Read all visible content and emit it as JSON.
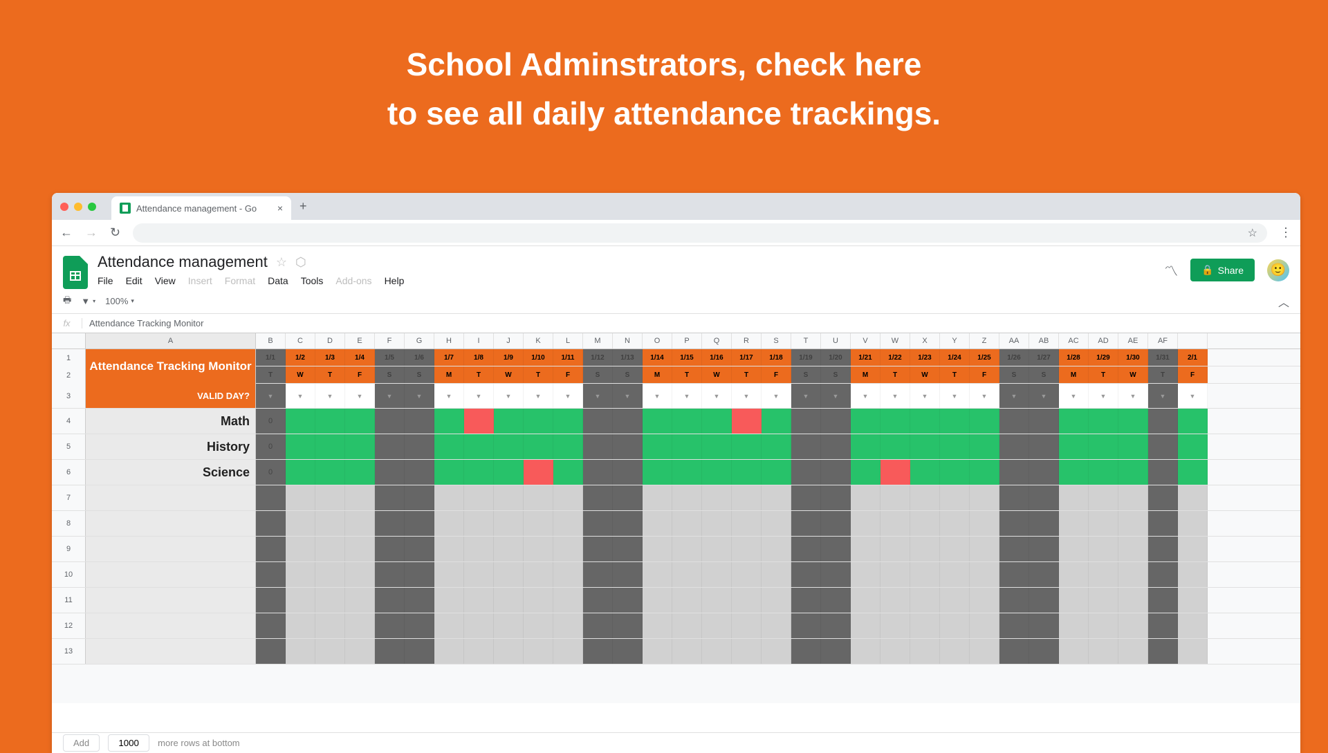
{
  "hero": {
    "line1": "School Adminstrators, check here",
    "line2": "to see all daily attendance trackings."
  },
  "browser": {
    "tab_title": "Attendance management - Go",
    "back": "←",
    "forward": "→",
    "reload": "⟳"
  },
  "sheets": {
    "doc_title": "Attendance management",
    "menus": [
      "File",
      "Edit",
      "View",
      "Insert",
      "Format",
      "Data",
      "Tools",
      "Add-ons",
      "Help"
    ],
    "menu_disabled": [
      "Insert",
      "Format",
      "Add-ons"
    ],
    "share_label": "Share",
    "zoom": "100%",
    "formula_text": "Attendance Tracking Monitor"
  },
  "grid": {
    "col_a": "A",
    "cols": [
      "B",
      "C",
      "D",
      "E",
      "F",
      "G",
      "H",
      "I",
      "J",
      "K",
      "L",
      "M",
      "N",
      "O",
      "P",
      "Q",
      "R",
      "S",
      "T",
      "U",
      "V",
      "W",
      "X",
      "Y",
      "Z",
      "AA",
      "AB",
      "AC",
      "AD",
      "AE",
      "AF",
      ""
    ],
    "row_nums": [
      "1",
      "2",
      "3",
      "4",
      "5",
      "6",
      "7",
      "8",
      "9",
      "10",
      "11",
      "12",
      "13"
    ],
    "title_merged": "Attendance Tracking Monitor",
    "valid_day_label": "VALID DAY?",
    "subjects": [
      "Math",
      "History",
      "Science"
    ],
    "subject_zero": "0",
    "dates": [
      {
        "label": "1/1",
        "type": "gray"
      },
      {
        "label": "1/2",
        "type": "orange"
      },
      {
        "label": "1/3",
        "type": "orange"
      },
      {
        "label": "1/4",
        "type": "orange"
      },
      {
        "label": "1/5",
        "type": "gray"
      },
      {
        "label": "1/6",
        "type": "gray"
      },
      {
        "label": "1/7",
        "type": "orange"
      },
      {
        "label": "1/8",
        "type": "orange"
      },
      {
        "label": "1/9",
        "type": "orange"
      },
      {
        "label": "1/10",
        "type": "orange"
      },
      {
        "label": "1/11",
        "type": "orange"
      },
      {
        "label": "1/12",
        "type": "gray"
      },
      {
        "label": "1/13",
        "type": "gray"
      },
      {
        "label": "1/14",
        "type": "orange"
      },
      {
        "label": "1/15",
        "type": "orange"
      },
      {
        "label": "1/16",
        "type": "orange"
      },
      {
        "label": "1/17",
        "type": "orange"
      },
      {
        "label": "1/18",
        "type": "orange"
      },
      {
        "label": "1/19",
        "type": "gray"
      },
      {
        "label": "1/20",
        "type": "gray"
      },
      {
        "label": "1/21",
        "type": "orange"
      },
      {
        "label": "1/22",
        "type": "orange"
      },
      {
        "label": "1/23",
        "type": "orange"
      },
      {
        "label": "1/24",
        "type": "orange"
      },
      {
        "label": "1/25",
        "type": "orange"
      },
      {
        "label": "1/26",
        "type": "gray"
      },
      {
        "label": "1/27",
        "type": "gray"
      },
      {
        "label": "1/28",
        "type": "orange"
      },
      {
        "label": "1/29",
        "type": "orange"
      },
      {
        "label": "1/30",
        "type": "orange"
      },
      {
        "label": "1/31",
        "type": "gray"
      },
      {
        "label": "2/1",
        "type": "orange"
      }
    ],
    "days": [
      {
        "label": "T",
        "type": "gray"
      },
      {
        "label": "W",
        "type": "orange"
      },
      {
        "label": "T",
        "type": "orange"
      },
      {
        "label": "F",
        "type": "orange"
      },
      {
        "label": "S",
        "type": "gray"
      },
      {
        "label": "S",
        "type": "gray"
      },
      {
        "label": "M",
        "type": "orange"
      },
      {
        "label": "T",
        "type": "orange"
      },
      {
        "label": "W",
        "type": "orange"
      },
      {
        "label": "T",
        "type": "orange"
      },
      {
        "label": "F",
        "type": "orange"
      },
      {
        "label": "S",
        "type": "gray"
      },
      {
        "label": "S",
        "type": "gray"
      },
      {
        "label": "M",
        "type": "orange"
      },
      {
        "label": "T",
        "type": "orange"
      },
      {
        "label": "W",
        "type": "orange"
      },
      {
        "label": "T",
        "type": "orange"
      },
      {
        "label": "F",
        "type": "orange"
      },
      {
        "label": "S",
        "type": "gray"
      },
      {
        "label": "S",
        "type": "gray"
      },
      {
        "label": "M",
        "type": "orange"
      },
      {
        "label": "T",
        "type": "orange"
      },
      {
        "label": "W",
        "type": "orange"
      },
      {
        "label": "T",
        "type": "orange"
      },
      {
        "label": "F",
        "type": "orange"
      },
      {
        "label": "S",
        "type": "gray"
      },
      {
        "label": "S",
        "type": "gray"
      },
      {
        "label": "M",
        "type": "orange"
      },
      {
        "label": "T",
        "type": "orange"
      },
      {
        "label": "W",
        "type": "orange"
      },
      {
        "label": "T",
        "type": "gray"
      },
      {
        "label": "F",
        "type": "orange"
      }
    ],
    "valid_row": [
      {
        "type": "darkgray",
        "arrow": true
      },
      {
        "type": "white",
        "arrow": true
      },
      {
        "type": "white",
        "arrow": true
      },
      {
        "type": "white",
        "arrow": true
      },
      {
        "type": "darkgray",
        "arrow": true
      },
      {
        "type": "darkgray",
        "arrow": true
      },
      {
        "type": "white",
        "arrow": true
      },
      {
        "type": "white",
        "arrow": true
      },
      {
        "type": "white",
        "arrow": true
      },
      {
        "type": "white",
        "arrow": true
      },
      {
        "type": "white",
        "arrow": true
      },
      {
        "type": "darkgray",
        "arrow": true
      },
      {
        "type": "darkgray",
        "arrow": true
      },
      {
        "type": "white",
        "arrow": true
      },
      {
        "type": "white",
        "arrow": true
      },
      {
        "type": "white",
        "arrow": true
      },
      {
        "type": "white",
        "arrow": true
      },
      {
        "type": "white",
        "arrow": true
      },
      {
        "type": "darkgray",
        "arrow": true
      },
      {
        "type": "darkgray",
        "arrow": true
      },
      {
        "type": "white",
        "arrow": true
      },
      {
        "type": "white",
        "arrow": true
      },
      {
        "type": "white",
        "arrow": true
      },
      {
        "type": "white",
        "arrow": true
      },
      {
        "type": "white",
        "arrow": true
      },
      {
        "type": "darkgray",
        "arrow": true
      },
      {
        "type": "darkgray",
        "arrow": true
      },
      {
        "type": "white",
        "arrow": true
      },
      {
        "type": "white",
        "arrow": true
      },
      {
        "type": "white",
        "arrow": true
      },
      {
        "type": "darkgray",
        "arrow": true
      },
      {
        "type": "white",
        "arrow": true
      }
    ],
    "math_row": [
      "darkgray",
      "green",
      "green",
      "green",
      "darkgray",
      "darkgray",
      "green",
      "red",
      "green",
      "green",
      "green",
      "darkgray",
      "darkgray",
      "green",
      "green",
      "green",
      "red",
      "green",
      "darkgray",
      "darkgray",
      "green",
      "green",
      "green",
      "green",
      "green",
      "darkgray",
      "darkgray",
      "green",
      "green",
      "green",
      "darkgray",
      "green"
    ],
    "history_row": [
      "darkgray",
      "green",
      "green",
      "green",
      "darkgray",
      "darkgray",
      "green",
      "green",
      "green",
      "green",
      "green",
      "darkgray",
      "darkgray",
      "green",
      "green",
      "green",
      "green",
      "green",
      "darkgray",
      "darkgray",
      "green",
      "green",
      "green",
      "green",
      "green",
      "darkgray",
      "darkgray",
      "green",
      "green",
      "green",
      "darkgray",
      "green"
    ],
    "science_row": [
      "darkgray",
      "green",
      "green",
      "green",
      "darkgray",
      "darkgray",
      "green",
      "green",
      "green",
      "red",
      "green",
      "darkgray",
      "darkgray",
      "green",
      "green",
      "green",
      "green",
      "green",
      "darkgray",
      "darkgray",
      "green",
      "red",
      "green",
      "green",
      "green",
      "darkgray",
      "darkgray",
      "green",
      "green",
      "green",
      "darkgray",
      "green"
    ]
  },
  "bottom": {
    "add": "Add",
    "rows": "1000",
    "more": "more rows at bottom"
  }
}
